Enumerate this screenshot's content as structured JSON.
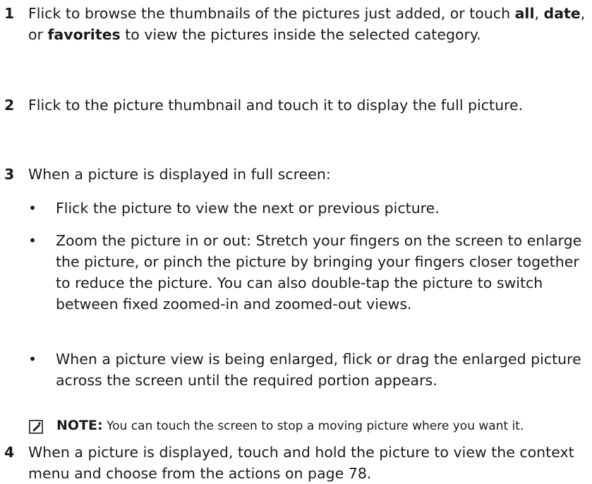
{
  "steps": [
    {
      "number": "1",
      "text_pre": "Flick to browse the thumbnails of the pictures just added, or touch ",
      "bold_all": "all",
      "sep1": ", ",
      "bold_date": "date",
      "sep2": ", or ",
      "bold_favorites": "favorites",
      "text_post": " to view the pictures inside the selected category."
    },
    {
      "number": "2",
      "text": "Flick to the picture thumbnail and touch it to display the full picture."
    },
    {
      "number": "3",
      "text": "When a picture is displayed in full screen:",
      "bullets": [
        "Flick the picture to view the next or previous picture.",
        "Zoom the picture in or out: Stretch your fingers on the screen to enlarge the picture, or pinch the picture by bringing your fingers closer together to reduce the picture. You can also double-tap the picture to switch between fixed zoomed-in and zoomed-out views.",
        "When a picture view is being enlarged, flick or drag the enlarged picture across the screen until the required portion appears."
      ],
      "bullet_symbol": "•"
    },
    {
      "number": "4",
      "text": "When a picture is displayed, touch and hold the picture to view the context menu and choose from the actions on page 78."
    }
  ],
  "note": {
    "label": "NOTE:",
    "text": " You can touch the screen to stop a moving picture where you want it.",
    "icon": "pencil-note-icon"
  }
}
